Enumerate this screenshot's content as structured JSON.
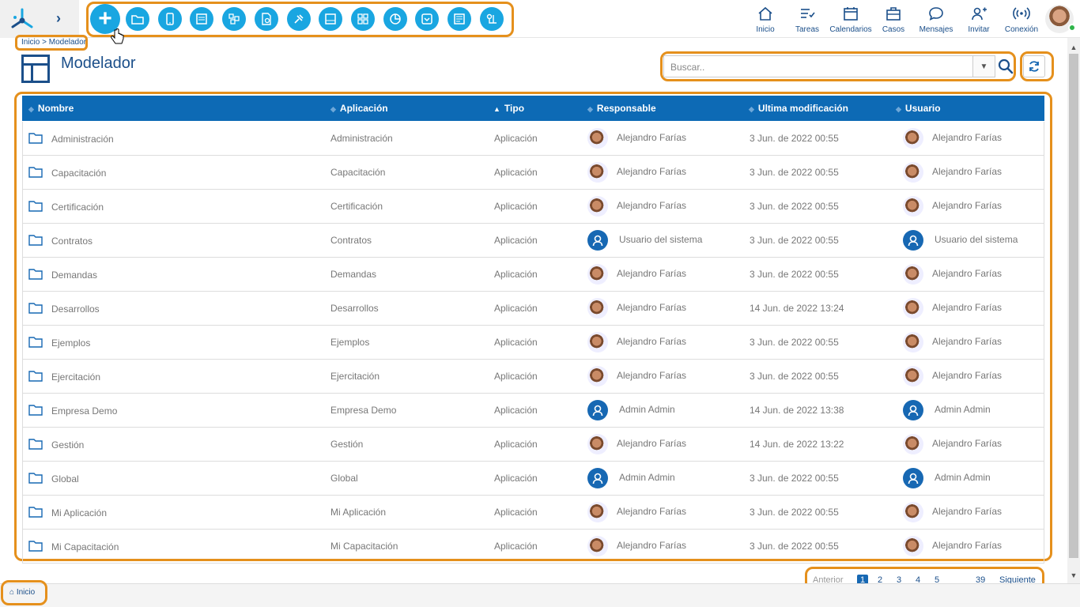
{
  "app": {
    "breadcrumb": "Inicio > Modelador",
    "page_title": "Modelador",
    "accent_color": "#19a6e1",
    "brand_color": "#1b4f8a",
    "highlight_color": "#e5901c"
  },
  "toolbar": {
    "add_icon": "plus-icon",
    "icons": [
      "folder-icon",
      "mobile-icon",
      "form-icon",
      "entities-icon",
      "document-gear-icon",
      "integration-plug-icon",
      "panel-icon",
      "dashboard-grid-icon",
      "chart-pie-icon",
      "dropdown-icon",
      "report-icon",
      "process-icon"
    ]
  },
  "nav": [
    {
      "label": "Inicio",
      "icon": "home-icon"
    },
    {
      "label": "Tareas",
      "icon": "tasks-icon"
    },
    {
      "label": "Calendarios",
      "icon": "calendar-icon"
    },
    {
      "label": "Casos",
      "icon": "briefcase-icon"
    },
    {
      "label": "Mensajes",
      "icon": "chat-icon"
    },
    {
      "label": "Invitar",
      "icon": "invite-user-icon"
    },
    {
      "label": "Conexión",
      "icon": "wireless-icon"
    }
  ],
  "search": {
    "placeholder": "Buscar.."
  },
  "table": {
    "columns": [
      "Nombre",
      "Aplicación",
      "Tipo",
      "Responsable",
      "Ultima modificación",
      "Usuario"
    ],
    "rows": [
      {
        "nombre": "Administración",
        "aplicacion": "Administración",
        "tipo": "Aplicación",
        "responsable": "Alejandro Farías",
        "modificacion": "3 Jun. de 2022 00:55",
        "usuario": "Alejandro Farías",
        "resp_sys": false,
        "user_sys": false
      },
      {
        "nombre": "Capacitación",
        "aplicacion": "Capacitación",
        "tipo": "Aplicación",
        "responsable": "Alejandro Farías",
        "modificacion": "3 Jun. de 2022 00:55",
        "usuario": "Alejandro Farías",
        "resp_sys": false,
        "user_sys": false
      },
      {
        "nombre": "Certificación",
        "aplicacion": "Certificación",
        "tipo": "Aplicación",
        "responsable": "Alejandro Farías",
        "modificacion": "3 Jun. de 2022 00:55",
        "usuario": "Alejandro Farías",
        "resp_sys": false,
        "user_sys": false
      },
      {
        "nombre": "Contratos",
        "aplicacion": "Contratos",
        "tipo": "Aplicación",
        "responsable": "Usuario del sistema",
        "modificacion": "3 Jun. de 2022 00:55",
        "usuario": "Usuario del sistema",
        "resp_sys": true,
        "user_sys": true
      },
      {
        "nombre": "Demandas",
        "aplicacion": "Demandas",
        "tipo": "Aplicación",
        "responsable": "Alejandro Farías",
        "modificacion": "3 Jun. de 2022 00:55",
        "usuario": "Alejandro Farías",
        "resp_sys": false,
        "user_sys": false
      },
      {
        "nombre": "Desarrollos",
        "aplicacion": "Desarrollos",
        "tipo": "Aplicación",
        "responsable": "Alejandro Farías",
        "modificacion": "14 Jun. de 2022 13:24",
        "usuario": "Alejandro Farías",
        "resp_sys": false,
        "user_sys": false
      },
      {
        "nombre": "Ejemplos",
        "aplicacion": "Ejemplos",
        "tipo": "Aplicación",
        "responsable": "Alejandro Farías",
        "modificacion": "3 Jun. de 2022 00:55",
        "usuario": "Alejandro Farías",
        "resp_sys": false,
        "user_sys": false
      },
      {
        "nombre": "Ejercitación",
        "aplicacion": "Ejercitación",
        "tipo": "Aplicación",
        "responsable": "Alejandro Farías",
        "modificacion": "3 Jun. de 2022 00:55",
        "usuario": "Alejandro Farías",
        "resp_sys": false,
        "user_sys": false
      },
      {
        "nombre": "Empresa Demo",
        "aplicacion": "Empresa Demo",
        "tipo": "Aplicación",
        "responsable": "Admin Admin",
        "modificacion": "14 Jun. de 2022 13:38",
        "usuario": "Admin Admin",
        "resp_sys": true,
        "user_sys": true
      },
      {
        "nombre": "Gestión",
        "aplicacion": "Gestión",
        "tipo": "Aplicación",
        "responsable": "Alejandro Farías",
        "modificacion": "14 Jun. de 2022 13:22",
        "usuario": "Alejandro Farías",
        "resp_sys": false,
        "user_sys": false
      },
      {
        "nombre": "Global",
        "aplicacion": "Global",
        "tipo": "Aplicación",
        "responsable": "Admin Admin",
        "modificacion": "3 Jun. de 2022 00:55",
        "usuario": "Admin Admin",
        "resp_sys": true,
        "user_sys": true
      },
      {
        "nombre": "Mi Aplicación",
        "aplicacion": "Mi Aplicación",
        "tipo": "Aplicación",
        "responsable": "Alejandro Farías",
        "modificacion": "3 Jun. de 2022 00:55",
        "usuario": "Alejandro Farías",
        "resp_sys": false,
        "user_sys": false
      },
      {
        "nombre": "Mi Capacitación",
        "aplicacion": "Mi Capacitación",
        "tipo": "Aplicación",
        "responsable": "Alejandro Farías",
        "modificacion": "3 Jun. de 2022 00:55",
        "usuario": "Alejandro Farías",
        "resp_sys": false,
        "user_sys": false
      }
    ]
  },
  "pagination": {
    "prev": "Anterior",
    "pages": [
      "1",
      "2",
      "3",
      "4",
      "5"
    ],
    "last": "39",
    "next": "Siguiente",
    "current": "1"
  },
  "bottom_tab": {
    "label": "Inicio"
  }
}
